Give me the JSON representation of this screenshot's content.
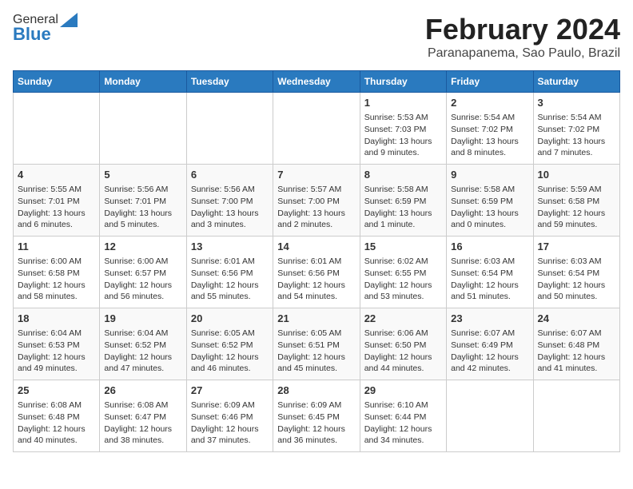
{
  "header": {
    "logo_general": "General",
    "logo_blue": "Blue",
    "title": "February 2024",
    "subtitle": "Paranapanema, Sao Paulo, Brazil"
  },
  "weekdays": [
    "Sunday",
    "Monday",
    "Tuesday",
    "Wednesday",
    "Thursday",
    "Friday",
    "Saturday"
  ],
  "weeks": [
    [
      {
        "day": "",
        "detail": ""
      },
      {
        "day": "",
        "detail": ""
      },
      {
        "day": "",
        "detail": ""
      },
      {
        "day": "",
        "detail": ""
      },
      {
        "day": "1",
        "detail": "Sunrise: 5:53 AM\nSunset: 7:03 PM\nDaylight: 13 hours\nand 9 minutes."
      },
      {
        "day": "2",
        "detail": "Sunrise: 5:54 AM\nSunset: 7:02 PM\nDaylight: 13 hours\nand 8 minutes."
      },
      {
        "day": "3",
        "detail": "Sunrise: 5:54 AM\nSunset: 7:02 PM\nDaylight: 13 hours\nand 7 minutes."
      }
    ],
    [
      {
        "day": "4",
        "detail": "Sunrise: 5:55 AM\nSunset: 7:01 PM\nDaylight: 13 hours\nand 6 minutes."
      },
      {
        "day": "5",
        "detail": "Sunrise: 5:56 AM\nSunset: 7:01 PM\nDaylight: 13 hours\nand 5 minutes."
      },
      {
        "day": "6",
        "detail": "Sunrise: 5:56 AM\nSunset: 7:00 PM\nDaylight: 13 hours\nand 3 minutes."
      },
      {
        "day": "7",
        "detail": "Sunrise: 5:57 AM\nSunset: 7:00 PM\nDaylight: 13 hours\nand 2 minutes."
      },
      {
        "day": "8",
        "detail": "Sunrise: 5:58 AM\nSunset: 6:59 PM\nDaylight: 13 hours\nand 1 minute."
      },
      {
        "day": "9",
        "detail": "Sunrise: 5:58 AM\nSunset: 6:59 PM\nDaylight: 13 hours\nand 0 minutes."
      },
      {
        "day": "10",
        "detail": "Sunrise: 5:59 AM\nSunset: 6:58 PM\nDaylight: 12 hours\nand 59 minutes."
      }
    ],
    [
      {
        "day": "11",
        "detail": "Sunrise: 6:00 AM\nSunset: 6:58 PM\nDaylight: 12 hours\nand 58 minutes."
      },
      {
        "day": "12",
        "detail": "Sunrise: 6:00 AM\nSunset: 6:57 PM\nDaylight: 12 hours\nand 56 minutes."
      },
      {
        "day": "13",
        "detail": "Sunrise: 6:01 AM\nSunset: 6:56 PM\nDaylight: 12 hours\nand 55 minutes."
      },
      {
        "day": "14",
        "detail": "Sunrise: 6:01 AM\nSunset: 6:56 PM\nDaylight: 12 hours\nand 54 minutes."
      },
      {
        "day": "15",
        "detail": "Sunrise: 6:02 AM\nSunset: 6:55 PM\nDaylight: 12 hours\nand 53 minutes."
      },
      {
        "day": "16",
        "detail": "Sunrise: 6:03 AM\nSunset: 6:54 PM\nDaylight: 12 hours\nand 51 minutes."
      },
      {
        "day": "17",
        "detail": "Sunrise: 6:03 AM\nSunset: 6:54 PM\nDaylight: 12 hours\nand 50 minutes."
      }
    ],
    [
      {
        "day": "18",
        "detail": "Sunrise: 6:04 AM\nSunset: 6:53 PM\nDaylight: 12 hours\nand 49 minutes."
      },
      {
        "day": "19",
        "detail": "Sunrise: 6:04 AM\nSunset: 6:52 PM\nDaylight: 12 hours\nand 47 minutes."
      },
      {
        "day": "20",
        "detail": "Sunrise: 6:05 AM\nSunset: 6:52 PM\nDaylight: 12 hours\nand 46 minutes."
      },
      {
        "day": "21",
        "detail": "Sunrise: 6:05 AM\nSunset: 6:51 PM\nDaylight: 12 hours\nand 45 minutes."
      },
      {
        "day": "22",
        "detail": "Sunrise: 6:06 AM\nSunset: 6:50 PM\nDaylight: 12 hours\nand 44 minutes."
      },
      {
        "day": "23",
        "detail": "Sunrise: 6:07 AM\nSunset: 6:49 PM\nDaylight: 12 hours\nand 42 minutes."
      },
      {
        "day": "24",
        "detail": "Sunrise: 6:07 AM\nSunset: 6:48 PM\nDaylight: 12 hours\nand 41 minutes."
      }
    ],
    [
      {
        "day": "25",
        "detail": "Sunrise: 6:08 AM\nSunset: 6:48 PM\nDaylight: 12 hours\nand 40 minutes."
      },
      {
        "day": "26",
        "detail": "Sunrise: 6:08 AM\nSunset: 6:47 PM\nDaylight: 12 hours\nand 38 minutes."
      },
      {
        "day": "27",
        "detail": "Sunrise: 6:09 AM\nSunset: 6:46 PM\nDaylight: 12 hours\nand 37 minutes."
      },
      {
        "day": "28",
        "detail": "Sunrise: 6:09 AM\nSunset: 6:45 PM\nDaylight: 12 hours\nand 36 minutes."
      },
      {
        "day": "29",
        "detail": "Sunrise: 6:10 AM\nSunset: 6:44 PM\nDaylight: 12 hours\nand 34 minutes."
      },
      {
        "day": "",
        "detail": ""
      },
      {
        "day": "",
        "detail": ""
      }
    ]
  ]
}
